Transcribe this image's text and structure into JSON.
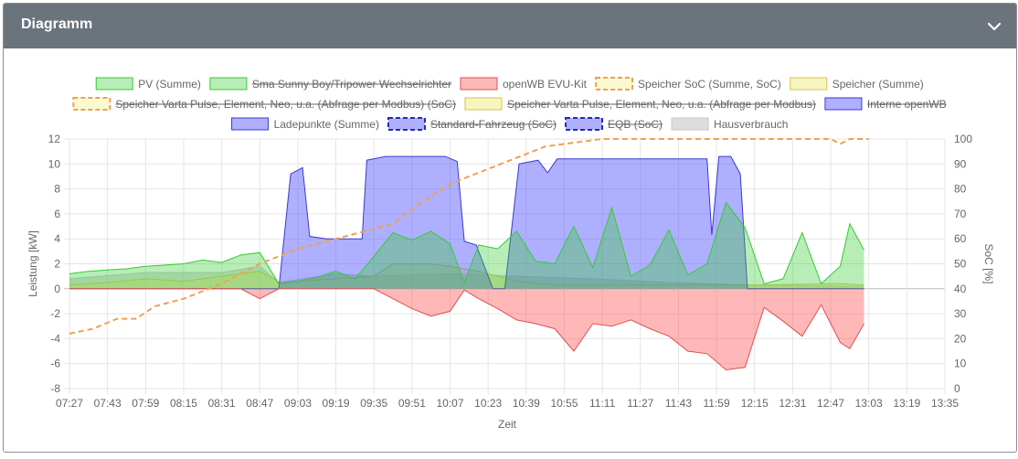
{
  "header": {
    "title": "Diagramm"
  },
  "colors": {
    "header_bg": "#6b737c",
    "pv": "#33cc33",
    "evu": "#ff4d4d",
    "speicher_soc": "#f0a050",
    "speicher": "#e6e64d",
    "ladepunkte": "#4d4dff",
    "hausverbrauch": "#b3b3b3"
  },
  "chart_data": {
    "type": "area",
    "xlabel": "Zeit",
    "ylabel": "Leistung [kW]",
    "y2label": "SoC [%]",
    "ylim": [
      -8,
      12
    ],
    "y2lim": [
      0,
      100
    ],
    "yticks": [
      -8,
      -6,
      -4,
      -2,
      0,
      2,
      4,
      6,
      8,
      10,
      12
    ],
    "y2ticks": [
      0,
      10,
      20,
      30,
      40,
      50,
      60,
      70,
      80,
      90,
      100
    ],
    "xticks": [
      "07:27",
      "07:43",
      "07:59",
      "08:15",
      "08:31",
      "08:47",
      "09:03",
      "09:19",
      "09:35",
      "09:51",
      "10:07",
      "10:23",
      "10:39",
      "10:55",
      "11:11",
      "11:27",
      "11:43",
      "11:59",
      "12:15",
      "12:31",
      "12:47",
      "13:03",
      "13:19",
      "13:35"
    ],
    "xlim": [
      "07:27",
      "13:35"
    ],
    "grid": true,
    "legend": [
      {
        "label": "PV (Summe)",
        "style": "pv",
        "hidden": false
      },
      {
        "label": "Sma Sunny Boy/Tripower Wechselrichter",
        "style": "pv",
        "hidden": true
      },
      {
        "label": "openWB EVU-Kit",
        "style": "evu",
        "hidden": false
      },
      {
        "label": "Speicher SoC (Summe, SoC)",
        "style": "soc",
        "hidden": false
      },
      {
        "label": "Speicher (Summe)",
        "style": "speicher",
        "hidden": false
      },
      {
        "label": "Speicher Varta Pulse, Element, Neo, u.a. (Abfrage per Modbus) (SoC)",
        "style": "soc",
        "hidden": true
      },
      {
        "label": "Speicher Varta Pulse, Element, Neo, u.a. (Abfrage per Modbus)",
        "style": "speicher",
        "hidden": true
      },
      {
        "label": "Interne openWB",
        "style": "ladepunkte",
        "hidden": true
      },
      {
        "label": "Ladepunkte (Summe)",
        "style": "ladepunkte",
        "hidden": false
      },
      {
        "label": "Standard-Fahrzeug (SoC)",
        "style": "ladesoc",
        "hidden": true
      },
      {
        "label": "EQB (SoC)",
        "style": "ladesoc",
        "hidden": true
      },
      {
        "label": "Hausverbrauch",
        "style": "haus",
        "hidden": false
      }
    ],
    "series": [
      {
        "name": "PV (Summe)",
        "style": "pv",
        "points": [
          [
            "07:27",
            1.2
          ],
          [
            "07:35",
            1.4
          ],
          [
            "07:43",
            1.5
          ],
          [
            "07:51",
            1.6
          ],
          [
            "07:59",
            1.8
          ],
          [
            "08:07",
            1.9
          ],
          [
            "08:15",
            2.0
          ],
          [
            "08:23",
            2.3
          ],
          [
            "08:31",
            2.1
          ],
          [
            "08:39",
            2.7
          ],
          [
            "08:47",
            2.9
          ],
          [
            "08:55",
            0.4
          ],
          [
            "09:03",
            0.6
          ],
          [
            "09:11",
            0.9
          ],
          [
            "09:19",
            1.4
          ],
          [
            "09:27",
            0.8
          ],
          [
            "09:35",
            2.6
          ],
          [
            "09:43",
            4.5
          ],
          [
            "09:51",
            3.9
          ],
          [
            "09:59",
            4.6
          ],
          [
            "10:07",
            3.6
          ],
          [
            "10:13",
            0.5
          ],
          [
            "10:19",
            3.5
          ],
          [
            "10:27",
            3.2
          ],
          [
            "10:35",
            4.6
          ],
          [
            "10:43",
            2.2
          ],
          [
            "10:51",
            2.0
          ],
          [
            "10:59",
            5.0
          ],
          [
            "11:07",
            1.7
          ],
          [
            "11:15",
            6.5
          ],
          [
            "11:23",
            1.0
          ],
          [
            "11:31",
            1.9
          ],
          [
            "11:39",
            4.7
          ],
          [
            "11:47",
            1.1
          ],
          [
            "11:55",
            2.0
          ],
          [
            "12:03",
            6.9
          ],
          [
            "12:11",
            4.9
          ],
          [
            "12:19",
            0.4
          ],
          [
            "12:27",
            0.8
          ],
          [
            "12:35",
            4.5
          ],
          [
            "12:43",
            0.4
          ],
          [
            "12:51",
            1.8
          ],
          [
            "12:55",
            5.2
          ],
          [
            "13:01",
            3.1
          ]
        ]
      },
      {
        "name": "openWB EVU-Kit",
        "style": "evu",
        "points": [
          [
            "07:27",
            0.0
          ],
          [
            "08:39",
            0.0
          ],
          [
            "08:47",
            -0.8
          ],
          [
            "08:55",
            0.0
          ],
          [
            "09:35",
            0.0
          ],
          [
            "09:43",
            -0.8
          ],
          [
            "09:51",
            -1.6
          ],
          [
            "09:59",
            -2.2
          ],
          [
            "10:07",
            -1.8
          ],
          [
            "10:13",
            -0.1
          ],
          [
            "10:19",
            -0.8
          ],
          [
            "10:27",
            -1.6
          ],
          [
            "10:35",
            -2.5
          ],
          [
            "10:43",
            -2.8
          ],
          [
            "10:51",
            -3.2
          ],
          [
            "10:59",
            -5.0
          ],
          [
            "11:07",
            -2.8
          ],
          [
            "11:15",
            -3.0
          ],
          [
            "11:23",
            -2.5
          ],
          [
            "11:31",
            -3.2
          ],
          [
            "11:39",
            -3.8
          ],
          [
            "11:47",
            -5.0
          ],
          [
            "11:55",
            -5.2
          ],
          [
            "12:03",
            -6.5
          ],
          [
            "12:11",
            -6.3
          ],
          [
            "12:19",
            -1.5
          ],
          [
            "12:27",
            -2.6
          ],
          [
            "12:35",
            -3.8
          ],
          [
            "12:43",
            -1.3
          ],
          [
            "12:51",
            -4.3
          ],
          [
            "12:55",
            -4.8
          ],
          [
            "13:01",
            -2.8
          ]
        ]
      },
      {
        "name": "Speicher (Summe)",
        "style": "speicher",
        "points": [
          [
            "07:27",
            0.3
          ],
          [
            "07:43",
            0.5
          ],
          [
            "07:59",
            0.8
          ],
          [
            "08:15",
            0.6
          ],
          [
            "08:31",
            1.0
          ],
          [
            "08:47",
            1.4
          ],
          [
            "08:55",
            0.5
          ],
          [
            "09:03",
            0.6
          ],
          [
            "09:19",
            0.8
          ],
          [
            "09:35",
            1.0
          ],
          [
            "09:43",
            2.0
          ],
          [
            "09:59",
            2.0
          ],
          [
            "10:07",
            1.8
          ],
          [
            "10:19",
            1.4
          ],
          [
            "10:35",
            0.6
          ],
          [
            "10:51",
            0.3
          ],
          [
            "11:07",
            0.3
          ],
          [
            "11:39",
            0.3
          ],
          [
            "12:15",
            0.3
          ],
          [
            "12:51",
            0.4
          ],
          [
            "13:01",
            0.3
          ]
        ]
      },
      {
        "name": "Ladepunkte (Summe)",
        "style": "ladepunkte",
        "points": [
          [
            "07:27",
            0.0
          ],
          [
            "08:55",
            0.0
          ],
          [
            "09:00",
            9.2
          ],
          [
            "09:05",
            9.7
          ],
          [
            "09:08",
            4.2
          ],
          [
            "09:15",
            4.0
          ],
          [
            "09:25",
            4.0
          ],
          [
            "09:30",
            4.0
          ],
          [
            "09:32",
            10.3
          ],
          [
            "09:40",
            10.6
          ],
          [
            "10:05",
            10.6
          ],
          [
            "10:10",
            10.2
          ],
          [
            "10:13",
            3.8
          ],
          [
            "10:18",
            3.5
          ],
          [
            "10:25",
            0.0
          ],
          [
            "10:30",
            0.0
          ],
          [
            "10:36",
            10.0
          ],
          [
            "10:44",
            10.3
          ],
          [
            "10:48",
            9.3
          ],
          [
            "10:52",
            10.4
          ],
          [
            "11:55",
            10.4
          ],
          [
            "11:57",
            4.3
          ],
          [
            "12:00",
            10.6
          ],
          [
            "12:05",
            10.6
          ],
          [
            "12:09",
            9.2
          ],
          [
            "12:12",
            0.0
          ],
          [
            "13:01",
            0.0
          ]
        ]
      },
      {
        "name": "Hausverbrauch",
        "style": "haus",
        "points": [
          [
            "07:27",
            0.8
          ],
          [
            "07:59",
            1.3
          ],
          [
            "08:31",
            1.3
          ],
          [
            "08:47",
            1.8
          ],
          [
            "08:55",
            0.5
          ],
          [
            "09:19",
            1.2
          ],
          [
            "09:35",
            1.0
          ],
          [
            "10:07",
            1.2
          ],
          [
            "10:35",
            1.0
          ],
          [
            "11:07",
            0.8
          ],
          [
            "11:39",
            0.5
          ],
          [
            "12:15",
            0.3
          ],
          [
            "13:01",
            0.2
          ]
        ]
      },
      {
        "name": "Speicher SoC (Summe, SoC)",
        "style": "soc",
        "axis": "right",
        "points": [
          [
            "07:27",
            22
          ],
          [
            "07:37",
            24
          ],
          [
            "07:47",
            28
          ],
          [
            "07:55",
            28
          ],
          [
            "08:03",
            33
          ],
          [
            "08:15",
            36
          ],
          [
            "08:31",
            42
          ],
          [
            "08:47",
            50
          ],
          [
            "09:03",
            56
          ],
          [
            "09:19",
            60
          ],
          [
            "09:35",
            64
          ],
          [
            "09:43",
            66
          ],
          [
            "09:51",
            72
          ],
          [
            "10:07",
            82
          ],
          [
            "10:23",
            88
          ],
          [
            "10:31",
            91
          ],
          [
            "10:39",
            94
          ],
          [
            "10:47",
            97
          ],
          [
            "11:03",
            99
          ],
          [
            "11:11",
            100
          ],
          [
            "12:47",
            100
          ],
          [
            "12:51",
            98
          ],
          [
            "12:55",
            100
          ],
          [
            "13:03",
            100
          ]
        ]
      }
    ]
  }
}
